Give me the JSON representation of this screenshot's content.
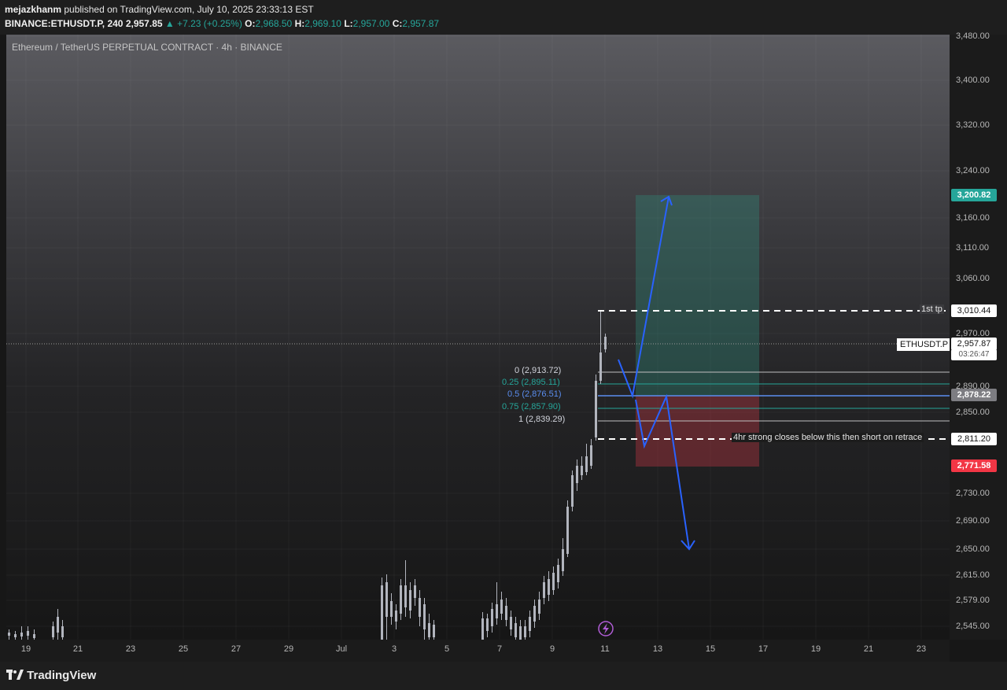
{
  "header": {
    "author": "mejazkhanm",
    "published_text": " published on TradingView.com, July 10, 2025 23:33:13 EST",
    "symbol": "BINANCE:ETHUSDT.P, 240",
    "last_price": "2,957.85",
    "change": "▲ +7.23 (+0.25%)",
    "o_label": "O:",
    "o_value": "2,968.50",
    "h_label": "H:",
    "h_value": "2,969.10",
    "l_label": "L:",
    "l_value": "2,957.00",
    "c_label": "C:",
    "c_value": "2,957.87"
  },
  "chart": {
    "instrument_title": "Ethereum / TetherUS PERPETUAL CONTRACT · 4h · BINANCE",
    "symbol_label": "ETHUSDT.P"
  },
  "price_axis": {
    "ticks": [
      "3,480.00",
      "3,400.00",
      "3,320.00",
      "3,240.00",
      "3,160.00",
      "3,110.00",
      "3,060.00",
      "2,970.00",
      "2,890.00",
      "2,850.00",
      "2,730.00",
      "2,690.00",
      "2,650.00",
      "2,615.00",
      "2,579.00",
      "2,545.00"
    ],
    "labels": {
      "target": "3,200.82",
      "first_tp": "3,010.44",
      "current": "2,957.87",
      "countdown": "03:26:47",
      "fib_mid": "2,878.22",
      "entry_line": "2,811.20",
      "stop": "2,771.58"
    }
  },
  "time_axis": {
    "ticks": [
      "19",
      "21",
      "23",
      "25",
      "27",
      "29",
      "Jul",
      "3",
      "5",
      "7",
      "9",
      "11",
      "13",
      "15",
      "17",
      "19",
      "21",
      "23"
    ]
  },
  "annotations": {
    "fib_0": "0 (2,913.72)",
    "fib_025": "0.25 (2,895.11)",
    "fib_05": "0.5 (2,876.51)",
    "fib_075": "0.75 (2,857.90)",
    "fib_1": "1 (2,839.29)",
    "first_tp_text": "1st tp",
    "strategy_text": "4hr strong closes below this then short on retrace"
  },
  "footer": {
    "brand": "TradingView"
  },
  "colors": {
    "up": "#26a69a",
    "down": "#ef5350",
    "arrow": "#2962ff",
    "target_bg": "#26a69a",
    "stop_bg": "#f23645",
    "fib_blue": "#5b8ef0"
  }
}
